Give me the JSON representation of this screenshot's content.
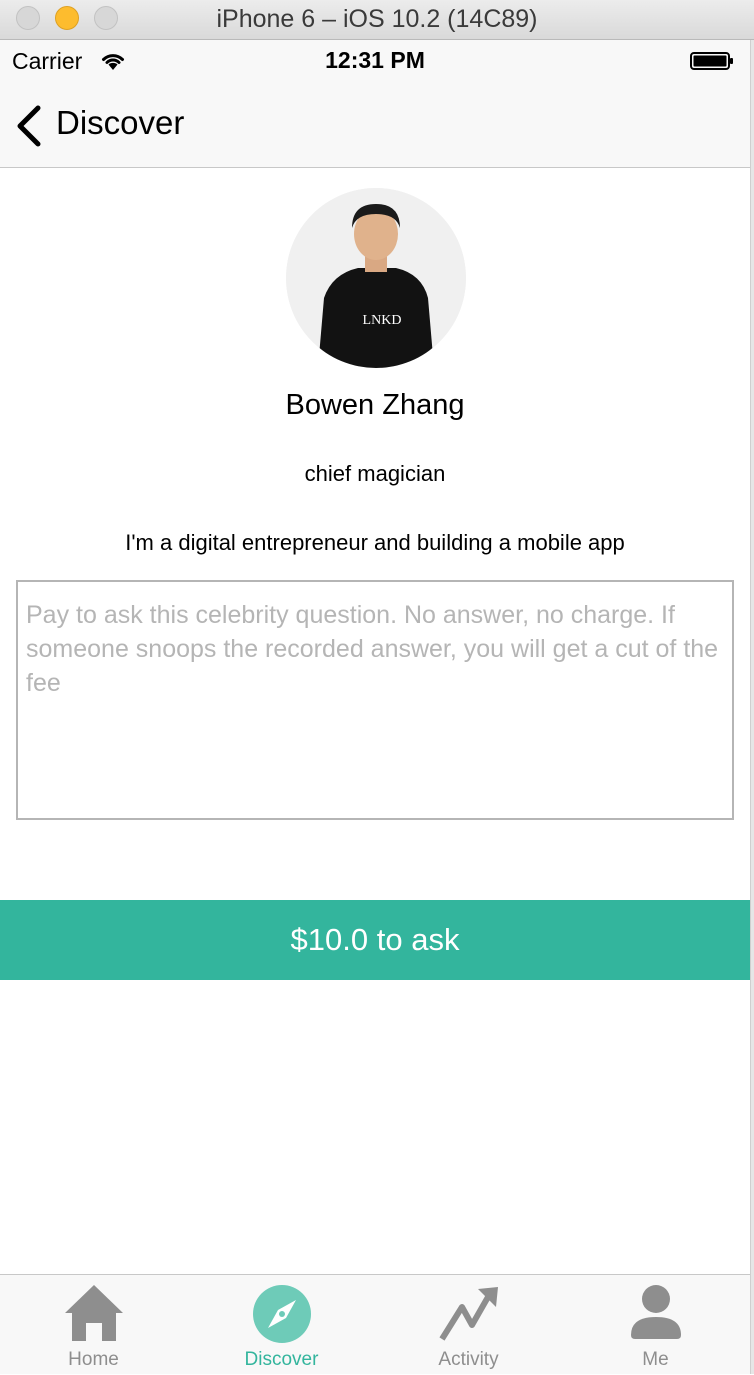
{
  "window": {
    "title": "iPhone 6 – iOS 10.2 (14C89)"
  },
  "status_bar": {
    "carrier": "Carrier",
    "time": "12:31 PM"
  },
  "nav": {
    "back_label": "Discover"
  },
  "profile": {
    "name": "Bowen Zhang",
    "title": "chief magician",
    "about": "I'm a digital entrepreneur and building a mobile app",
    "avatar_shirt_text": "LNKD"
  },
  "question": {
    "placeholder": "Pay to ask this celebrity question. No answer, no charge. If someone snoops the recorded answer, you will get a cut of the fee",
    "value": ""
  },
  "ask_button": {
    "label": "$10.0 to ask"
  },
  "tabs": [
    {
      "label": "Home",
      "icon": "home-icon",
      "active": false
    },
    {
      "label": "Discover",
      "icon": "compass-icon",
      "active": true
    },
    {
      "label": "Activity",
      "icon": "activity-icon",
      "active": false
    },
    {
      "label": "Me",
      "icon": "person-icon",
      "active": false
    }
  ],
  "colors": {
    "accent": "#33b59d",
    "tab_inactive": "#8e8e8e",
    "bar_background": "#f8f8f8"
  }
}
